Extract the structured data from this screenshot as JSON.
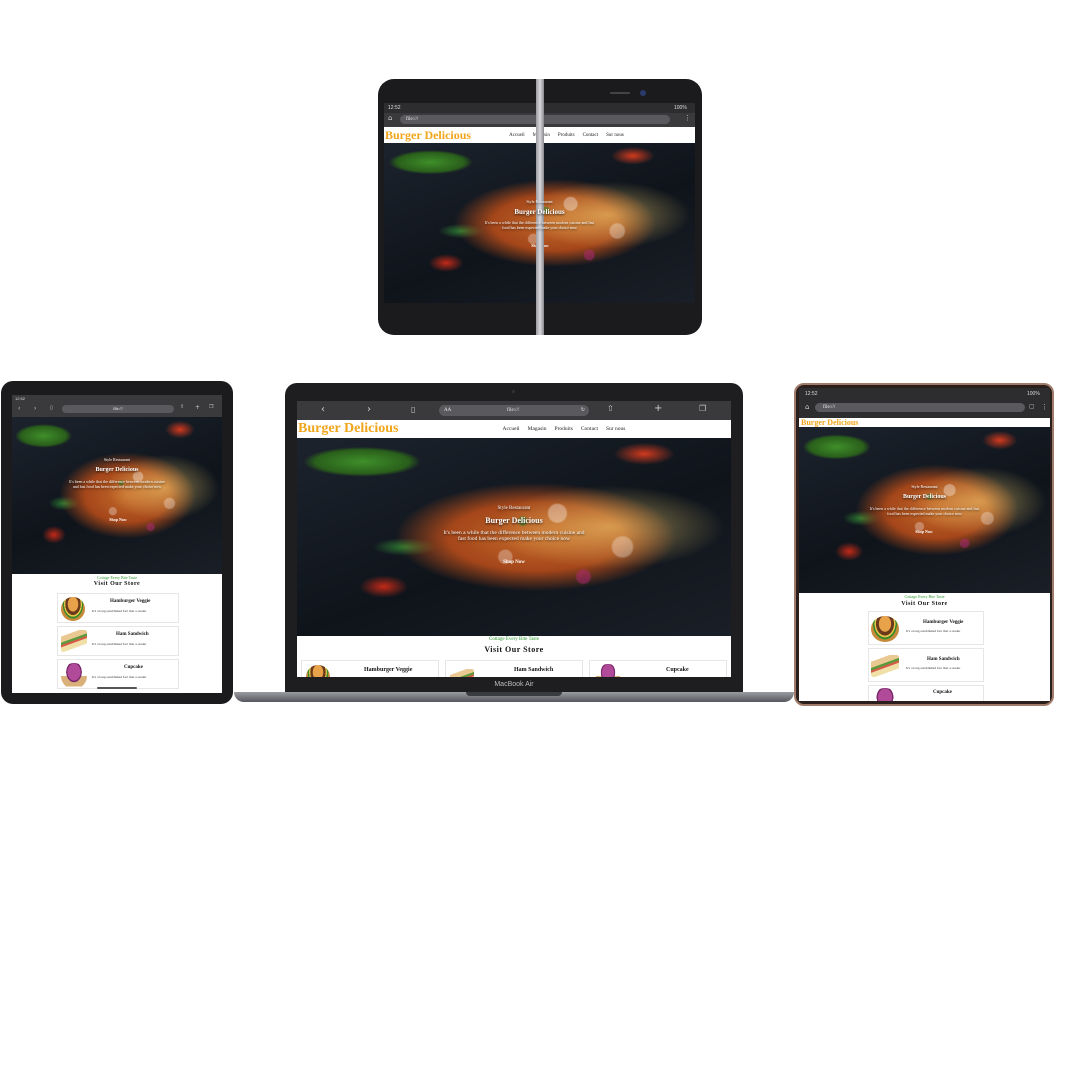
{
  "site": {
    "brand": "Burger Delicious",
    "menu": [
      "Accueil",
      "Magasin",
      "Produits",
      "Contact",
      "Sur nous"
    ],
    "hero_kicker": "Style Restaurant",
    "hero_title": "Burger Delicious",
    "hero_text": "It's been a while that the difference between modern cuisine and fast food has been expected make your choice now",
    "shop_button": "Shop Now",
    "green_line": "Cottage Every Bite Taste",
    "store_title": "Visit Our Store",
    "products": [
      {
        "name": "Hamburger Veggie",
        "desc": "It's a long established fact that a reader",
        "image": "burger"
      },
      {
        "name": "Ham Sandwich",
        "desc": "It's a long established fact that a reader",
        "image": "sandwich"
      },
      {
        "name": "Cupcake",
        "desc": "It's a long established fact that a reader",
        "image": "cupcake"
      }
    ]
  },
  "browser": {
    "url": "file:///",
    "url_bar_prefix": "AA",
    "status_time": "12:52",
    "status_battery": "100%"
  },
  "laptop": {
    "model_label": "MacBook Air"
  }
}
